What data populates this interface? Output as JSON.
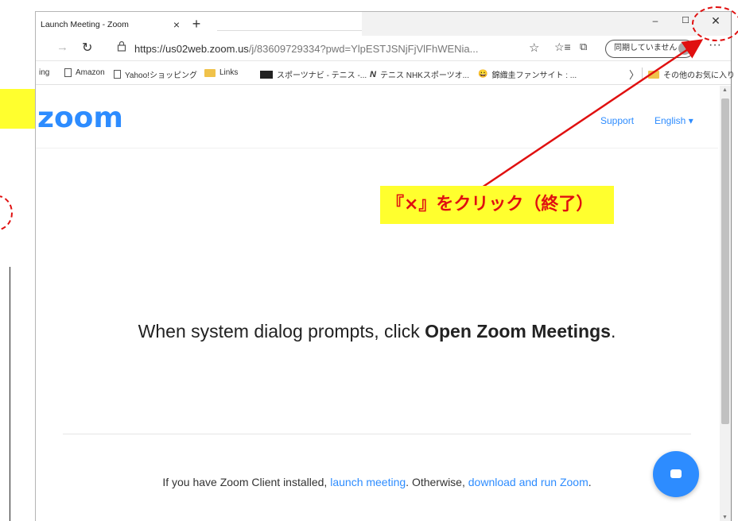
{
  "browser": {
    "tab_title": "Launch Meeting - Zoom",
    "tab_close_glyph": "×",
    "new_tab_glyph": "+",
    "window_min_glyph": "–",
    "window_max_glyph": "☐",
    "window_close_glyph": "✕",
    "forward_glyph": "→",
    "reload_glyph": "↻",
    "lock_glyph": "🔒",
    "url_host": "https://us02web.zoom.us",
    "url_path": "/j/83609729334?pwd=YlpESTJSNjFjVlFhWENia...",
    "star_glyph": "☆",
    "favorites_glyph": "☆≡",
    "collections_glyph": "⧉",
    "sync_label": "同期していません",
    "more_glyph": "···",
    "bookmarks": [
      {
        "icon": "ing",
        "label": "ing"
      },
      {
        "icon": "page",
        "label": "Amazon"
      },
      {
        "icon": "page",
        "label": "Yahoo!ショッピング"
      },
      {
        "icon": "folder",
        "label": "Links"
      },
      {
        "icon": "black",
        "label": "スポーツナビ - テニス -..."
      },
      {
        "icon": "nhk",
        "label": "テニス NHKスポーツオ..."
      },
      {
        "icon": "face",
        "label": "錦織圭ファンサイト : ..."
      }
    ],
    "bookmarks_chevron": "〉",
    "other_favorites": "その他のお気に入り"
  },
  "page": {
    "logo": "zoom",
    "support": "Support",
    "language": "English ▾",
    "message_prefix": "When system dialog prompts, click ",
    "message_bold": "Open Zoom Meetings",
    "message_suffix": ".",
    "hint_prefix": "If you have Zoom Client installed, ",
    "hint_link1": "launch meeting",
    "hint_middle": ". Otherwise, ",
    "hint_link2": "download and run Zoom",
    "hint_suffix": "."
  },
  "annotation": {
    "label": "『×』をクリック（終了）"
  },
  "colors": {
    "zoom_blue": "#2d8cff",
    "annotation_red": "#e01010",
    "annotation_yellow": "#ffff2e"
  }
}
